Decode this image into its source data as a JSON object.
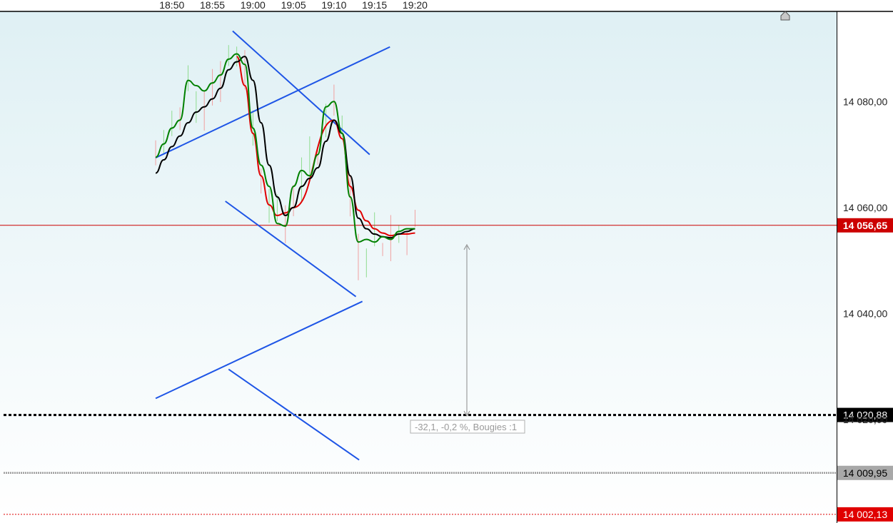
{
  "chart_data": {
    "type": "candlestick",
    "xlabel": "",
    "ylabel": "",
    "x_ticks": [
      "18:50",
      "18:55",
      "19:00",
      "19:05",
      "19:10",
      "19:15",
      "19:20"
    ],
    "y_ticks": [
      "14 080,00",
      "14 060,00",
      "14 040,00",
      "14 020,00"
    ],
    "ylim": [
      14000.5,
      14097.0
    ],
    "xlim_minutes": [
      18.48,
      20.2
    ],
    "current_price": {
      "label": "14 056,65",
      "value": 14056.65,
      "color": "#cc0000"
    },
    "levels": [
      {
        "name": "level-black-dotted",
        "label": "14 020,88",
        "value": 14020.88,
        "color": "#000000",
        "style": "dotted"
      },
      {
        "name": "level-grey-dotted",
        "label": "14 009,95",
        "value": 14009.95,
        "color": "#9b9b9b",
        "style": "dotted"
      },
      {
        "name": "level-red-dotted",
        "label": "14 002,13",
        "value": 14002.13,
        "color": "#e00000",
        "style": "dotted"
      }
    ],
    "measure_label": "-32,1, -0,2 %, Bougies :1",
    "series": [
      {
        "name": "",
        "color": "#008000",
        "x": [
          "18:48",
          "18:49",
          "18:50",
          "18:51",
          "18:52",
          "18:53",
          "18:54",
          "18:55",
          "18:56",
          "18:57",
          "18:58",
          "18:59",
          "19:00",
          "19:01",
          "19:02",
          "19:03",
          "19:04",
          "19:05",
          "19:06",
          "19:07",
          "19:08",
          "19:09",
          "19:10",
          "19:11",
          "19:12",
          "19:13",
          "19:14",
          "19:15",
          "19:16",
          "19:17",
          "19:18",
          "19:19",
          "19:20"
        ],
        "values": [
          14069.5,
          14072,
          14075,
          14076.5,
          14084,
          14083,
          14082,
          14083.5,
          14085,
          14088,
          14089,
          14087,
          14075,
          14068,
          14064,
          14057,
          14056.5,
          14064,
          14067,
          14066,
          14070,
          14079,
          14080,
          14074,
          14062,
          14053.5,
          14054,
          14053.5,
          14054.5,
          14054,
          14055.5,
          14056,
          14056
        ]
      },
      {
        "name": "",
        "color": "#000000",
        "x": [
          "18:48",
          "18:49",
          "18:50",
          "18:51",
          "18:52",
          "18:53",
          "18:54",
          "18:55",
          "18:56",
          "18:57",
          "18:58",
          "18:59",
          "19:00",
          "19:01",
          "19:02",
          "19:03",
          "19:04",
          "19:05",
          "19:06",
          "19:07",
          "19:08",
          "19:09",
          "19:10",
          "19:11",
          "19:12",
          "19:13",
          "19:14",
          "19:15",
          "19:16",
          "19:17",
          "19:18",
          "19:19",
          "19:20"
        ],
        "values": [
          14066.5,
          14069,
          14071.5,
          14073.5,
          14076,
          14078,
          14079,
          14080.5,
          14082.5,
          14086,
          14087.5,
          14088.5,
          14084,
          14076,
          14068,
          14062,
          14058.5,
          14060,
          14064,
          14065.5,
          14067.5,
          14072.5,
          14076.5,
          14074,
          14066,
          14058,
          14056,
          14055,
          14054.5,
          14054.3,
          14055,
          14055.5,
          14056
        ]
      },
      {
        "name": "",
        "color": "#e00000",
        "x": [
          "18:58",
          "18:59",
          "19:00",
          "19:01",
          "19:02",
          "19:03",
          "19:04",
          "19:05",
          "19:10",
          "19:11",
          "19:12",
          "19:13",
          "19:14",
          "19:15",
          "19:16",
          "19:17",
          "19:18",
          "19:19",
          "19:20"
        ],
        "values": [
          14088.5,
          14083,
          14074,
          14066,
          14060.5,
          14058.5,
          14059,
          14060,
          14076.5,
          14073,
          14064,
          14059.5,
          14057.5,
          14056,
          14055.2,
          14054.7,
          14055,
          14055,
          14055.2
        ]
      }
    ],
    "trendlines": [
      {
        "x": [
          "18:57.5",
          "19:14.4"
        ],
        "values": [
          14093.3,
          14070.0
        ]
      },
      {
        "x": [
          "18:48.0",
          "19:16.9"
        ],
        "values": [
          14069.4,
          14090.3
        ]
      },
      {
        "x": [
          "18:56.6",
          "19:12.7"
        ],
        "values": [
          14061.2,
          14043.2
        ]
      },
      {
        "x": [
          "18:48.0",
          "19:13.5"
        ],
        "values": [
          14024.0,
          14042.3
        ]
      },
      {
        "x": [
          "18:57.0",
          "19:13.1"
        ],
        "values": [
          14029.5,
          14012.4
        ]
      }
    ],
    "grid": false,
    "legend": "none"
  },
  "colors": {
    "background_top": "#dff0f4",
    "background_bottom": "#ffffff",
    "axis": "#000000",
    "trendline": "#1e55e6",
    "candle_up": "#8fdc8f",
    "candle_down": "#f0a0a0"
  },
  "marker_icon": "home-arrow-icon"
}
